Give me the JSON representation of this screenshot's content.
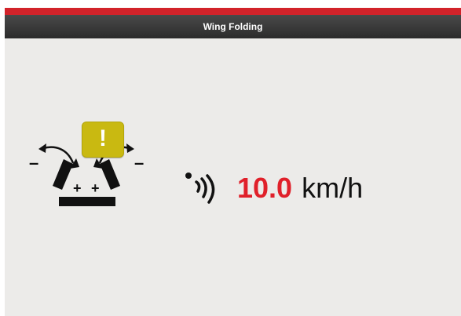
{
  "header": {
    "title": "Wing Folding",
    "accent_color": "#d2232a"
  },
  "status": {
    "warning_icon": "exclamation-warning-icon",
    "warning_symbol": "!",
    "warning_color": "#c9b911",
    "wing_icon": "wing-fold-icon",
    "wing_symbols": {
      "left_minus": "–",
      "right_minus": "–",
      "left_plus": "+",
      "right_plus": "+"
    }
  },
  "speed": {
    "icon": "speed-sensor-wave-icon",
    "value": "10.0",
    "value_color": "#e0202a",
    "unit": "km/h"
  }
}
